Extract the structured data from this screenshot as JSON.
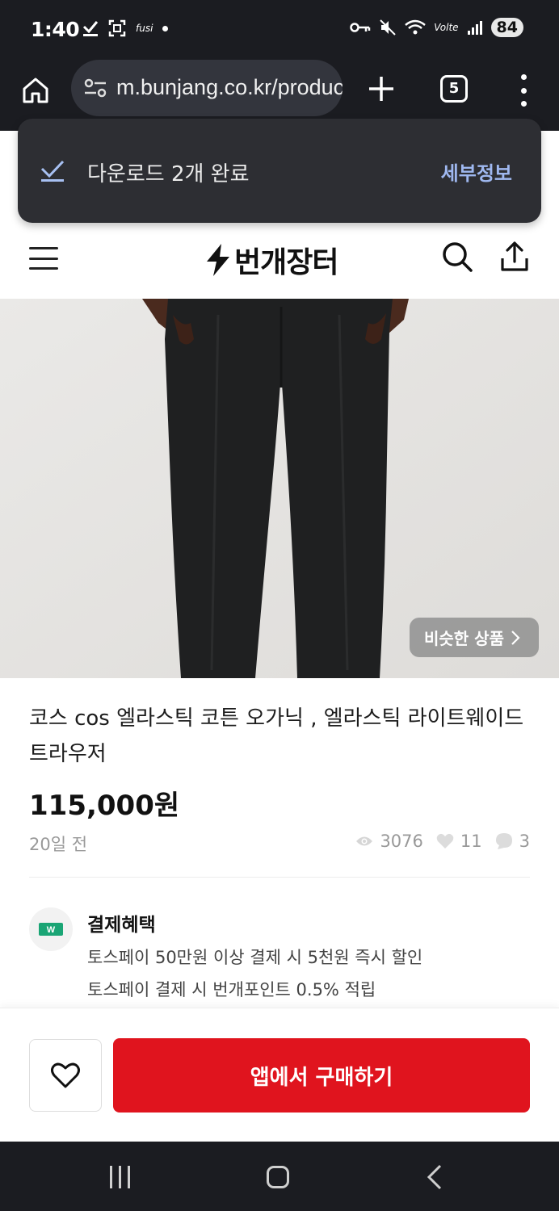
{
  "status_bar": {
    "time": "1:40",
    "left_text": "fusi",
    "network_label": "Volte",
    "battery": "84"
  },
  "browser": {
    "url": "m.bunjang.co.kr/products",
    "tab_count": "5"
  },
  "toast": {
    "message": "다운로드 2개 완료",
    "action": "세부정보"
  },
  "site": {
    "logo_text": "번개장터"
  },
  "product": {
    "similar_button": "비슷한 상품",
    "title": "코스 cos 엘라스틱 코튼 오가닉 , 엘라스틱 라이트웨이드 트라우저",
    "price": "115,000원",
    "time_ago": "20일 전",
    "views": "3076",
    "likes": "11",
    "chats": "3"
  },
  "benefit": {
    "icon_text": "W",
    "title": "결제혜택",
    "line1": "토스페이 50만원 이상 결제 시 5천원 즉시 할인",
    "line2": "토스페이 결제 시 번개포인트 0.5% 적립"
  },
  "actions": {
    "buy_label": "앱에서 구매하기"
  },
  "colors": {
    "accent_red": "#e0141e",
    "toast_link": "#9fb8f0",
    "benefit_green": "#1aa575"
  }
}
